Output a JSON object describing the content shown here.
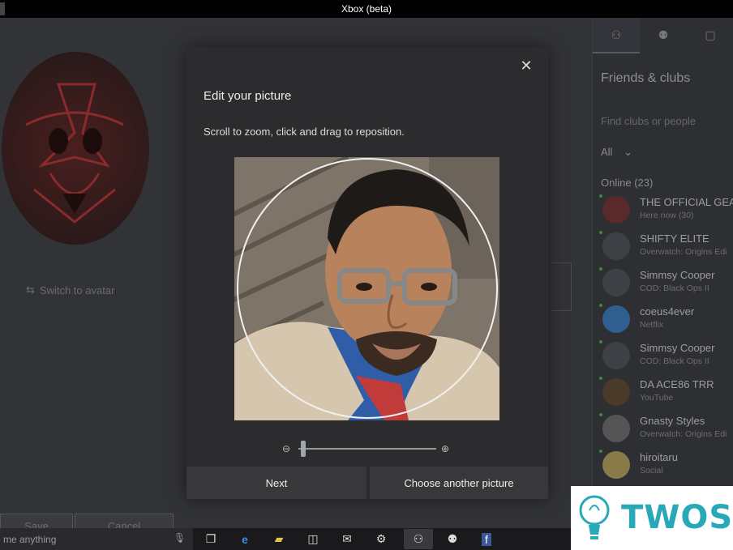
{
  "window": {
    "title": "Xbox (beta)"
  },
  "background": {
    "switch_avatar": "Switch to avatar",
    "save_label": "Save",
    "cancel_label": "Cancel"
  },
  "friends_pane": {
    "title": "Friends & clubs",
    "search_placeholder": "Find clubs or people",
    "filter": "All",
    "online_header": "Online (23)",
    "friends": [
      {
        "name": "THE OFFICIAL GEAR",
        "status": "Here now (30)",
        "pic_color": "#5a2a2a"
      },
      {
        "name": "SHIFTY ELITE",
        "status": "Overwatch: Origins Edi",
        "pic_color": "#3f4045"
      },
      {
        "name": "Simmsy Cooper",
        "status": "COD: Black Ops II",
        "pic_color": "#3f4045"
      },
      {
        "name": "coeus4ever",
        "status": "Netflix",
        "pic_color": "#2f5f8f"
      },
      {
        "name": "Simmsy Cooper",
        "status": "COD: Black Ops II",
        "pic_color": "#3f4045"
      },
      {
        "name": "DA ACE86 TRR",
        "status": "YouTube",
        "pic_color": "#4a3a2a"
      },
      {
        "name": "Gnasty Styles",
        "status": "Overwatch: Origins Edi",
        "pic_color": "#555"
      },
      {
        "name": "hiroitaru",
        "status": "Social",
        "pic_color": "#8a7a4a"
      }
    ]
  },
  "dialog": {
    "title": "Edit your picture",
    "hint": "Scroll to zoom, click and drag to reposition.",
    "zoom_level": 0.02,
    "next_label": "Next",
    "choose_label": "Choose another picture"
  },
  "taskbar": {
    "search_text": "me anything"
  },
  "watermark": {
    "text": "TWOS"
  }
}
